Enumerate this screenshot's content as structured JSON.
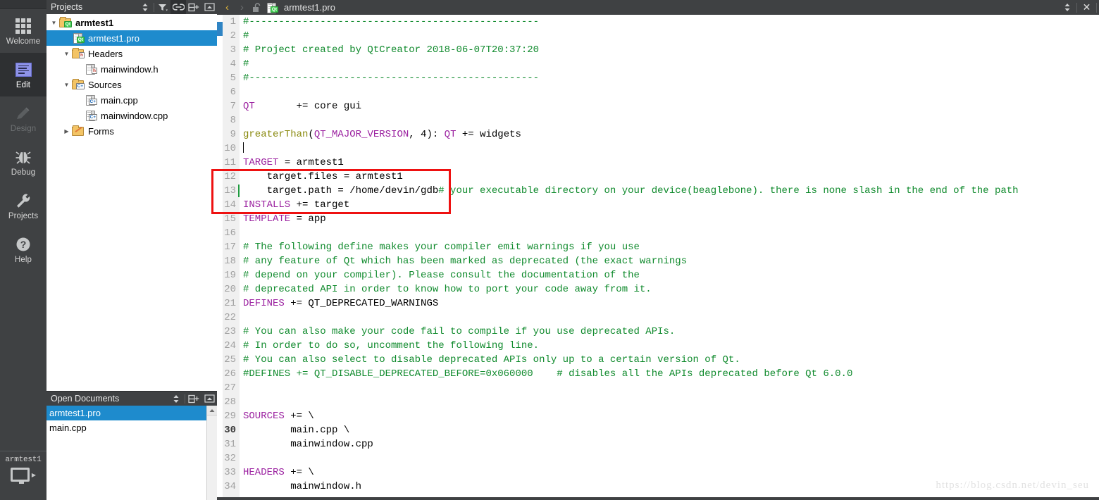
{
  "modebar": {
    "items": [
      {
        "label": "Welcome",
        "icon": "grid-icon",
        "state": "normal"
      },
      {
        "label": "Edit",
        "icon": "edit-icon",
        "state": "active"
      },
      {
        "label": "Design",
        "icon": "pencil-icon",
        "state": "disabled"
      },
      {
        "label": "Debug",
        "icon": "bug-icon",
        "state": "normal"
      },
      {
        "label": "Projects",
        "icon": "wrench-icon",
        "state": "normal"
      },
      {
        "label": "Help",
        "icon": "question-icon",
        "state": "normal"
      }
    ]
  },
  "kit_selector": {
    "name": "armtest1",
    "icon": "desktop-monitor-icon",
    "arrow": "▶"
  },
  "projects_panel": {
    "title": "Projects",
    "buttons": [
      {
        "name": "view-selector",
        "glyph": "↕"
      },
      {
        "name": "filter-icon",
        "glyph": "filter"
      },
      {
        "name": "link-icon",
        "glyph": "link",
        "active": true
      },
      {
        "name": "split-icon",
        "glyph": "split"
      },
      {
        "name": "close-panel-icon",
        "glyph": "minimize"
      }
    ],
    "tree": [
      {
        "label": "armtest1",
        "indent": 0,
        "arrow": "down",
        "icon": "qt-project-folder-icon",
        "bold": true,
        "selected": false
      },
      {
        "label": "armtest1.pro",
        "indent": 1,
        "arrow": "none",
        "icon": "qt-pro-file-icon",
        "bold": false,
        "selected": true
      },
      {
        "label": "Headers",
        "indent": 1,
        "arrow": "down",
        "icon": "headers-folder-icon",
        "bold": false,
        "selected": false
      },
      {
        "label": "mainwindow.h",
        "indent": 2,
        "arrow": "none",
        "icon": "h-file-icon",
        "bold": false,
        "selected": false
      },
      {
        "label": "Sources",
        "indent": 1,
        "arrow": "down",
        "icon": "sources-folder-icon",
        "bold": false,
        "selected": false
      },
      {
        "label": "main.cpp",
        "indent": 2,
        "arrow": "none",
        "icon": "cpp-file-icon",
        "bold": false,
        "selected": false
      },
      {
        "label": "mainwindow.cpp",
        "indent": 2,
        "arrow": "none",
        "icon": "cpp-file-icon",
        "bold": false,
        "selected": false
      },
      {
        "label": "Forms",
        "indent": 1,
        "arrow": "right",
        "icon": "forms-folder-icon",
        "bold": false,
        "selected": false
      }
    ]
  },
  "open_documents": {
    "title": "Open Documents",
    "buttons": [
      {
        "name": "view-selector",
        "glyph": "↕"
      },
      {
        "name": "split-icon",
        "glyph": "split"
      },
      {
        "name": "close-panel-icon",
        "glyph": "minimize"
      }
    ],
    "items": [
      {
        "label": "armtest1.pro",
        "selected": true
      },
      {
        "label": "main.cpp",
        "selected": false
      }
    ]
  },
  "editor_tabbar": {
    "back_glyph": "‹",
    "forward_glyph": "›",
    "lock_icon": "unlocked-padlock-icon",
    "file_icon": "qt-pro-file-icon",
    "filename": "armtest1.pro",
    "selector_glyph": "↕",
    "close_glyph": "✕"
  },
  "code": {
    "current_line": 30,
    "modified_line": 13,
    "caret_line": 10,
    "blue_mark_line": 2,
    "lines": [
      {
        "n": 1,
        "segs": [
          {
            "t": "#-------------------------------------------------",
            "c": "cm"
          }
        ]
      },
      {
        "n": 2,
        "segs": [
          {
            "t": "#",
            "c": "cm"
          }
        ]
      },
      {
        "n": 3,
        "segs": [
          {
            "t": "# Project created by QtCreator 2018-06-07T20:37:20",
            "c": "cm"
          }
        ]
      },
      {
        "n": 4,
        "segs": [
          {
            "t": "#",
            "c": "cm"
          }
        ]
      },
      {
        "n": 5,
        "segs": [
          {
            "t": "#-------------------------------------------------",
            "c": "cm"
          }
        ]
      },
      {
        "n": 6,
        "segs": []
      },
      {
        "n": 7,
        "segs": [
          {
            "t": "QT",
            "c": "kw"
          },
          {
            "t": "       += core gui",
            "c": "pl"
          }
        ]
      },
      {
        "n": 8,
        "segs": []
      },
      {
        "n": 9,
        "segs": [
          {
            "t": "greaterThan",
            "c": "fn"
          },
          {
            "t": "(",
            "c": "pl"
          },
          {
            "t": "QT_MAJOR_VERSION",
            "c": "kw"
          },
          {
            "t": ", 4): ",
            "c": "pl"
          },
          {
            "t": "QT",
            "c": "kw"
          },
          {
            "t": " += widgets",
            "c": "pl"
          }
        ]
      },
      {
        "n": 10,
        "segs": []
      },
      {
        "n": 11,
        "segs": [
          {
            "t": "TARGET",
            "c": "kw"
          },
          {
            "t": " = armtest1",
            "c": "pl"
          }
        ]
      },
      {
        "n": 12,
        "segs": [
          {
            "t": "    target.files = armtest1",
            "c": "pl"
          }
        ]
      },
      {
        "n": 13,
        "segs": [
          {
            "t": "    target.path = /home/devin/gdb",
            "c": "pl"
          },
          {
            "t": "# your executable directory on your device(beaglebone). there is none slash in the end of the path",
            "c": "cm"
          }
        ]
      },
      {
        "n": 14,
        "segs": [
          {
            "t": "INSTALLS",
            "c": "kw"
          },
          {
            "t": " += target",
            "c": "pl"
          }
        ]
      },
      {
        "n": 15,
        "segs": [
          {
            "t": "TEMPLATE",
            "c": "kw"
          },
          {
            "t": " = app",
            "c": "pl"
          }
        ]
      },
      {
        "n": 16,
        "segs": []
      },
      {
        "n": 17,
        "segs": [
          {
            "t": "# The following define makes your compiler emit warnings if you use",
            "c": "cm"
          }
        ]
      },
      {
        "n": 18,
        "segs": [
          {
            "t": "# any feature of Qt which has been marked as deprecated (the exact warnings",
            "c": "cm"
          }
        ]
      },
      {
        "n": 19,
        "segs": [
          {
            "t": "# depend on your compiler). Please consult the documentation of the",
            "c": "cm"
          }
        ]
      },
      {
        "n": 20,
        "segs": [
          {
            "t": "# deprecated API in order to know how to port your code away from it.",
            "c": "cm"
          }
        ]
      },
      {
        "n": 21,
        "segs": [
          {
            "t": "DEFINES",
            "c": "kw"
          },
          {
            "t": " += QT_DEPRECATED_WARNINGS",
            "c": "pl"
          }
        ]
      },
      {
        "n": 22,
        "segs": []
      },
      {
        "n": 23,
        "segs": [
          {
            "t": "# You can also make your code fail to compile if you use deprecated APIs.",
            "c": "cm"
          }
        ]
      },
      {
        "n": 24,
        "segs": [
          {
            "t": "# In order to do so, uncomment the following line.",
            "c": "cm"
          }
        ]
      },
      {
        "n": 25,
        "segs": [
          {
            "t": "# You can also select to disable deprecated APIs only up to a certain version of Qt.",
            "c": "cm"
          }
        ]
      },
      {
        "n": 26,
        "segs": [
          {
            "t": "#DEFINES += QT_DISABLE_DEPRECATED_BEFORE=0x060000    # disables all the APIs deprecated before Qt 6.0.0",
            "c": "cm"
          }
        ]
      },
      {
        "n": 27,
        "segs": []
      },
      {
        "n": 28,
        "segs": []
      },
      {
        "n": 29,
        "segs": [
          {
            "t": "SOURCES",
            "c": "kw"
          },
          {
            "t": " += \\",
            "c": "pl"
          }
        ]
      },
      {
        "n": 30,
        "segs": [
          {
            "t": "        main.cpp \\",
            "c": "pl"
          }
        ]
      },
      {
        "n": 31,
        "segs": [
          {
            "t": "        mainwindow.cpp",
            "c": "pl"
          }
        ]
      },
      {
        "n": 32,
        "segs": []
      },
      {
        "n": 33,
        "segs": [
          {
            "t": "HEADERS",
            "c": "kw"
          },
          {
            "t": " += \\",
            "c": "pl"
          }
        ]
      },
      {
        "n": 34,
        "segs": [
          {
            "t": "        mainwindow.h",
            "c": "pl"
          }
        ]
      }
    ]
  },
  "annotation": {
    "color": "#ee1111",
    "highlights_lines": [
      12,
      13,
      14
    ]
  },
  "watermark": {
    "text": "https://blog.csdn.net/devin_seu"
  },
  "colors": {
    "chrome": "#3f4143",
    "selection_blue": "#1e8bcd",
    "comment_green": "#0f8a2c",
    "keyword_purple": "#9b21a0",
    "function_olive": "#8a8a0f",
    "annotation_red": "#ee1111",
    "gutter_bg": "#f0f0f0"
  }
}
